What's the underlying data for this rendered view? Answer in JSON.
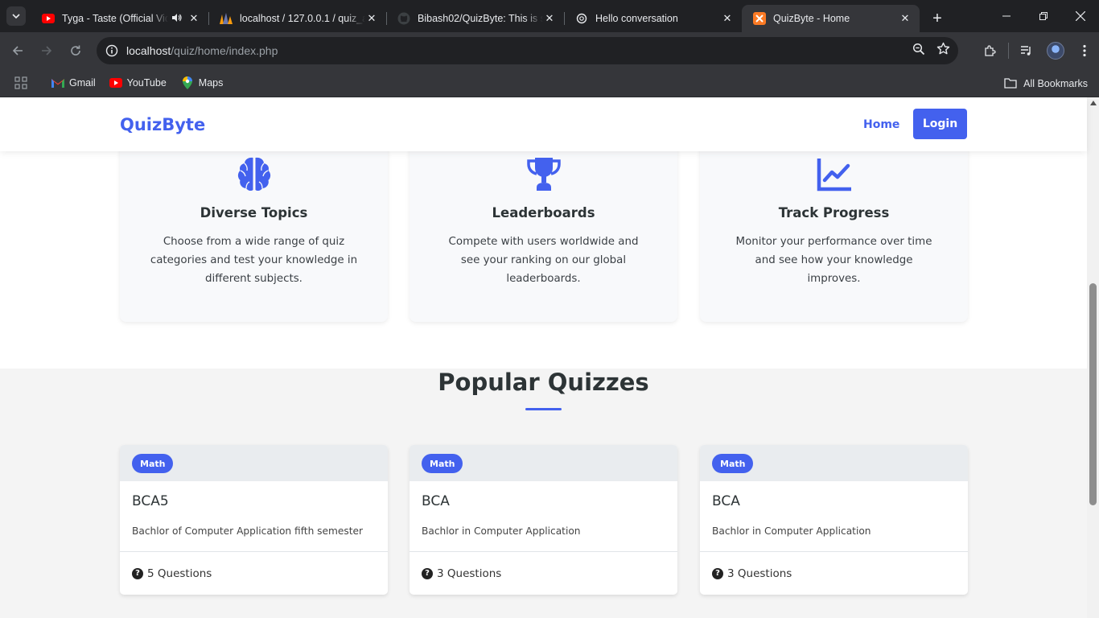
{
  "browser": {
    "tabs": [
      {
        "title": "Tyga - Taste (Official Video)",
        "favicon": "youtube-icon",
        "audio": true,
        "active": false
      },
      {
        "title": "localhost / 127.0.0.1 / quiz_app",
        "favicon": "phpmyadmin-icon",
        "audio": false,
        "active": false
      },
      {
        "title": "Bibash02/QuizByte: This is simple",
        "favicon": "github-icon",
        "audio": false,
        "active": false
      },
      {
        "title": "Hello conversation",
        "favicon": "chatgpt-icon",
        "audio": false,
        "active": false
      },
      {
        "title": "QuizByte - Home",
        "favicon": "xampp-icon",
        "audio": false,
        "active": true
      }
    ],
    "url_host": "localhost",
    "url_path": "/quiz/home/index.php",
    "bookmarks": [
      {
        "label": "Gmail",
        "icon": "gmail-icon"
      },
      {
        "label": "YouTube",
        "icon": "youtube-icon"
      },
      {
        "label": "Maps",
        "icon": "maps-icon"
      }
    ],
    "all_bookmarks": "All Bookmarks"
  },
  "site": {
    "brand": "QuizByte",
    "nav_home": "Home",
    "nav_login": "Login",
    "accent": "#4361ee"
  },
  "features": [
    {
      "icon": "brain-icon",
      "title": "Diverse Topics",
      "text": "Choose from a wide range of quiz categories and test your knowledge in different subjects."
    },
    {
      "icon": "trophy-icon",
      "title": "Leaderboards",
      "text": "Compete with users worldwide and see your ranking on our global leaderboards."
    },
    {
      "icon": "chart-line-icon",
      "title": "Track Progress",
      "text": "Monitor your performance over time and see how your knowledge improves."
    }
  ],
  "popular": {
    "title": "Popular Quizzes",
    "quizzes": [
      {
        "category": "Math",
        "name": "BCA5",
        "description": "Bachlor of Computer Application fifth semester",
        "questions": "5 Questions"
      },
      {
        "category": "Math",
        "name": "BCA",
        "description": "Bachlor in Computer Application",
        "questions": "3 Questions"
      },
      {
        "category": "Math",
        "name": "BCA",
        "description": "Bachlor in Computer Application",
        "questions": "3 Questions"
      }
    ]
  }
}
